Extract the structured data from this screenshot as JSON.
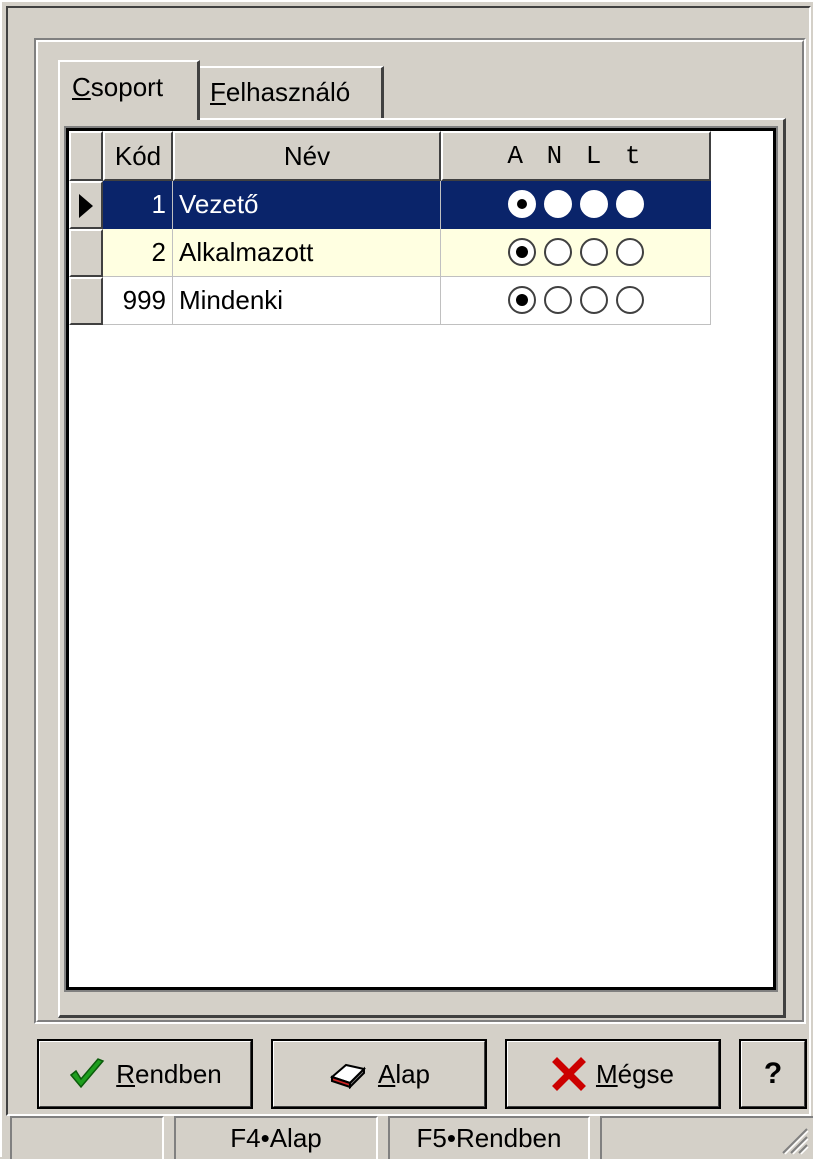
{
  "tabs": [
    {
      "label": "Csoport",
      "mnemonic": "C",
      "rest": "soport",
      "active": true
    },
    {
      "label": "Felhasználó",
      "mnemonic": "F",
      "rest": "elhasználó",
      "active": false
    }
  ],
  "grid": {
    "columns": [
      "Kód",
      "Név",
      "A N L t"
    ],
    "rows": [
      {
        "kod": "1",
        "nev": "Vezető",
        "rights": [
          true,
          false,
          false,
          false
        ],
        "selected": true
      },
      {
        "kod": "2",
        "nev": "Alkalmazott",
        "rights": [
          true,
          false,
          false,
          false
        ],
        "selected": false
      },
      {
        "kod": "999",
        "nev": "Mindenki",
        "rights": [
          true,
          false,
          false,
          false
        ],
        "selected": false
      }
    ]
  },
  "buttons": {
    "ok": {
      "mnemonic": "R",
      "rest": "endben",
      "icon": "checkmark-icon",
      "color": "#1e9e1e"
    },
    "alap": {
      "mnemonic": "A",
      "rest": "lap",
      "icon": "eraser-icon"
    },
    "cancel": {
      "mnemonic": "M",
      "rest": "égse",
      "icon": "x-icon",
      "color": "#cc0000"
    },
    "help": {
      "label": "?"
    }
  },
  "status": {
    "f4": "F4•Alap",
    "f5": "F5•Rendben"
  },
  "colors": {
    "face": "#d4d0c8",
    "selection": "#0a246a",
    "alt_row": "#ffffe1"
  }
}
